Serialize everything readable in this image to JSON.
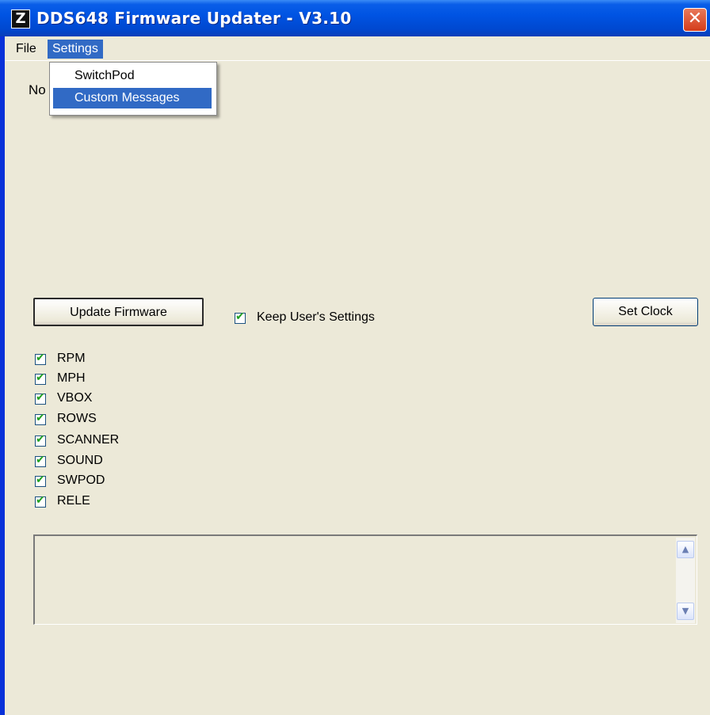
{
  "window": {
    "title": "DDS648 Firmware Updater - V3.10",
    "close_glyph": "✕",
    "app_icon_glyph": "Z"
  },
  "menubar": {
    "items": [
      {
        "label": "File"
      },
      {
        "label": "Settings"
      }
    ]
  },
  "settings_menu": {
    "items": [
      {
        "label": "SwitchPod"
      },
      {
        "label": "Custom Messages"
      }
    ]
  },
  "status_text": "No",
  "buttons": {
    "update_firmware": "Update Firmware",
    "set_clock": "Set Clock"
  },
  "keep_settings": {
    "label": "Keep User's Settings",
    "checked": true
  },
  "modules": [
    {
      "label": "RPM",
      "checked": true
    },
    {
      "label": "MPH",
      "checked": true
    },
    {
      "label": "VBOX",
      "checked": true
    },
    {
      "label": "ROWS",
      "checked": true
    },
    {
      "label": "SCANNER",
      "checked": true
    },
    {
      "label": "SOUND",
      "checked": true
    },
    {
      "label": "SWPOD",
      "checked": true
    },
    {
      "label": "RELE",
      "checked": true
    }
  ],
  "log": {
    "text": ""
  },
  "scroll_glyphs": {
    "up": "▲",
    "down": "▼"
  },
  "colors": {
    "titlebar": "#0054e3",
    "selection": "#316ac5",
    "window_bg": "#ece9d8"
  }
}
